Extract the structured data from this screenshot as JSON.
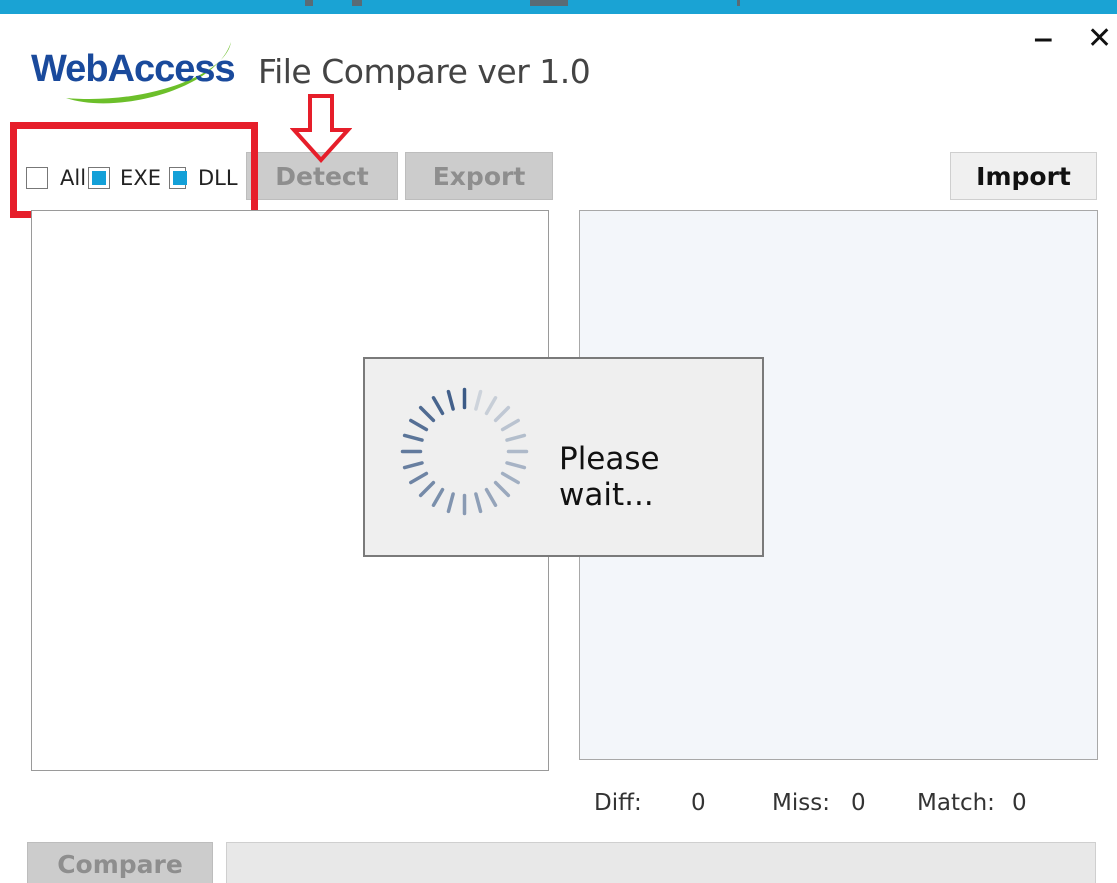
{
  "app": {
    "logo_text": "WebAccess",
    "title": "File Compare ver 1.0"
  },
  "window": {
    "minimize_glyph": "‒",
    "close_glyph": "✕"
  },
  "filters": {
    "all_label": "All",
    "exe_label": "EXE",
    "dll_label": "DLL",
    "all_checked": false,
    "exe_checked": true,
    "dll_checked": true
  },
  "toolbar": {
    "detect_label": "Detect",
    "export_label": "Export",
    "import_label": "Import"
  },
  "dialog": {
    "message": "Please wait..."
  },
  "stats": {
    "diff_label": "Diff:",
    "diff_value": "0",
    "miss_label": "Miss:",
    "miss_value": "0",
    "match_label": "Match:",
    "match_value": "0"
  },
  "bottom": {
    "compare_label": "Compare"
  },
  "colors": {
    "accent": "#1aa3d4",
    "checkbox_fill": "#13a0d8",
    "annotation_red": "#e61e2a",
    "logo_blue": "#1a4a9c",
    "logo_green": "#6cbf2a"
  },
  "icons": {
    "spinner": "loading-spinner-icon",
    "annotation_arrow": "arrow-down-icon"
  }
}
